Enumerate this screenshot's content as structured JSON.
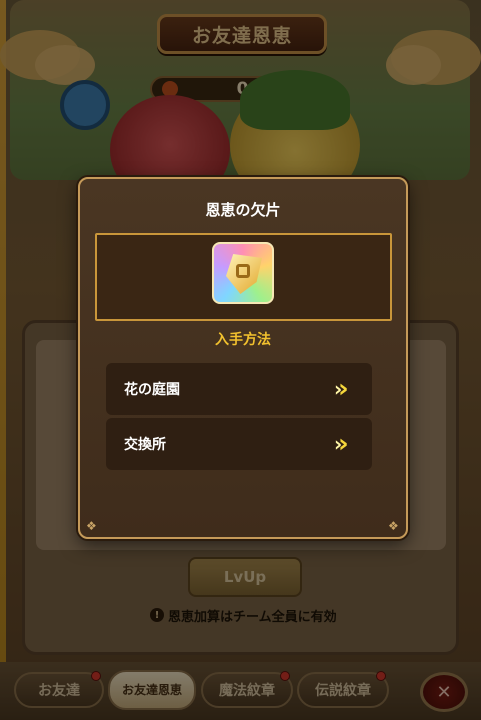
{
  "background": {
    "title": "お友達恩恵",
    "count": "0",
    "lvup_label": "LvUp",
    "notice": "恩恵加算はチーム全員に有効",
    "tabs": [
      {
        "label": "お友達",
        "badge": true
      },
      {
        "label": "お友達恩恵",
        "badge": false
      },
      {
        "label": "魔法紋章",
        "badge": true
      },
      {
        "label": "伝説紋章",
        "badge": true
      }
    ],
    "close_icon": "close-icon"
  },
  "modal": {
    "title": "恩恵の欠片",
    "item_icon": "shard-icon",
    "acquire_heading": "入手方法",
    "routes": [
      {
        "label": "花の庭園",
        "icon": "double-chevron-right-icon"
      },
      {
        "label": "交換所",
        "icon": "double-chevron-right-icon"
      }
    ]
  },
  "colors": {
    "accent_gold": "#f2c12e",
    "panel_border": "#c59a59",
    "route_bg": "#2f1f12"
  }
}
